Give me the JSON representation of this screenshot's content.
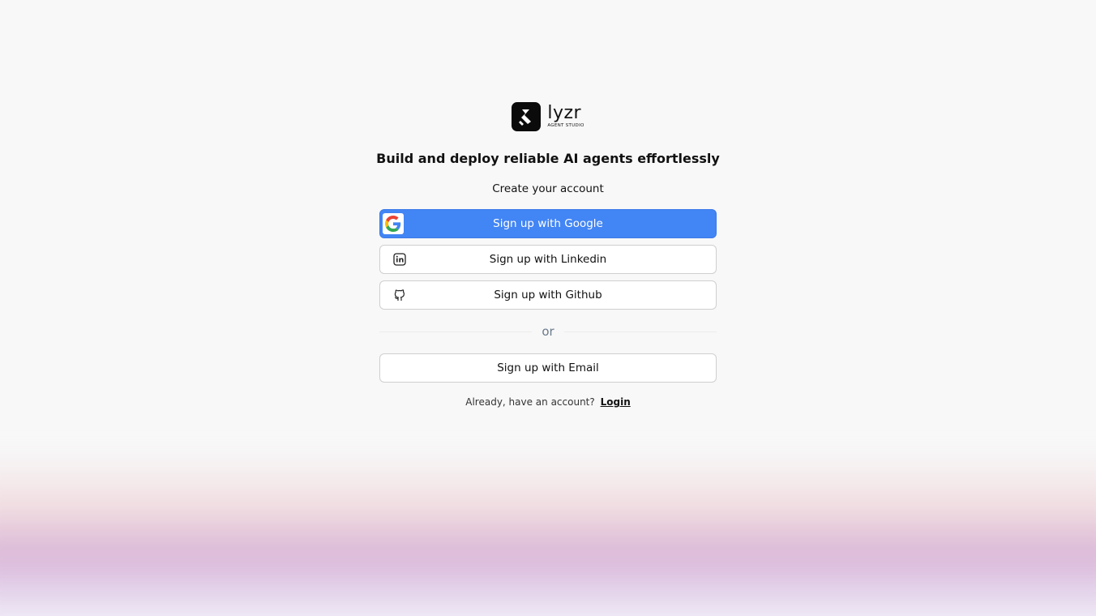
{
  "brand": {
    "name": "lyzr",
    "tagline": "AGENT STUDIO"
  },
  "headline": "Build and deploy reliable AI agents effortlessly",
  "subhead": "Create your account",
  "buttons": {
    "google": "Sign up with Google",
    "linkedin": "Sign up with Linkedin",
    "github": "Sign up with Github",
    "email": "Sign up with Email"
  },
  "divider_text": "or",
  "footer": {
    "prompt": "Already, have an account?",
    "login_link": "Login"
  },
  "icons": {
    "logo": "lyzr-logo-icon",
    "google": "google-icon",
    "linkedin": "linkedin-icon",
    "github": "github-icon"
  },
  "colors": {
    "google_button": "#4285f4",
    "background": "#f8f8f8",
    "logo_bg": "#0b0b0b"
  }
}
